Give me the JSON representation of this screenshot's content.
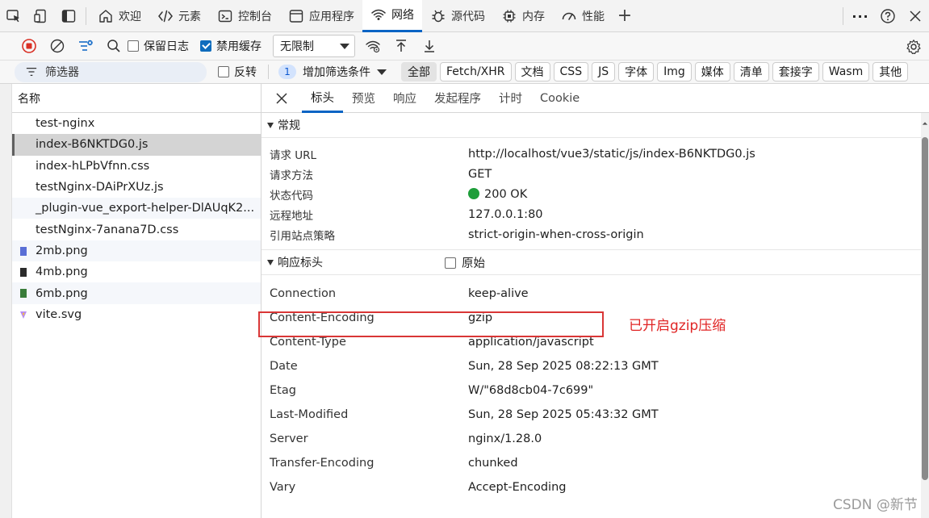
{
  "topbar": {
    "tabs": [
      {
        "label": "欢迎",
        "icon": "home-icon"
      },
      {
        "label": "元素",
        "icon": "code-icon"
      },
      {
        "label": "控制台",
        "icon": "console-icon"
      },
      {
        "label": "应用程序",
        "icon": "application-icon"
      },
      {
        "label": "网络",
        "icon": "wifi-icon",
        "active": true
      },
      {
        "label": "源代码",
        "icon": "bug-icon"
      },
      {
        "label": "内存",
        "icon": "memory-icon"
      },
      {
        "label": "性能",
        "icon": "performance-icon"
      }
    ],
    "add_tab": "+",
    "more": "···",
    "help": "?",
    "close": "✕"
  },
  "toolbar": {
    "preserve_log_label": "保留日志",
    "preserve_log_checked": false,
    "disable_cache_label": "禁用缓存",
    "disable_cache_checked": true,
    "throttling_value": "无限制"
  },
  "filterbar": {
    "filter_placeholder": "筛选器",
    "invert_label": "反转",
    "invert_checked": false,
    "more_filters_count": "1",
    "more_filters_label": "增加筛选条件",
    "types": [
      "全部",
      "Fetch/XHR",
      "文档",
      "CSS",
      "JS",
      "字体",
      "Img",
      "媒体",
      "清单",
      "套接字",
      "Wasm",
      "其他"
    ],
    "active_type": "全部"
  },
  "requests": {
    "header": "名称",
    "items": [
      {
        "name": "test-nginx",
        "type": "doc"
      },
      {
        "name": "index-B6NKTDG0.js",
        "type": "js",
        "selected": true
      },
      {
        "name": "index-hLPbVfnn.css",
        "type": "css"
      },
      {
        "name": "testNginx-DAiPrXUz.js",
        "type": "js"
      },
      {
        "name": "_plugin-vue_export-helper-DlAUqK2...",
        "type": "js"
      },
      {
        "name": "testNginx-7anana7D.css",
        "type": "css"
      },
      {
        "name": "2mb.png",
        "type": "img",
        "icon_color": "#5a6fd6"
      },
      {
        "name": "4mb.png",
        "type": "img",
        "icon_color": "#2b2b2b"
      },
      {
        "name": "6mb.png",
        "type": "img",
        "icon_color": "#3a7d3a"
      },
      {
        "name": "vite.svg",
        "type": "svg",
        "icon_color": "#b68cf5"
      }
    ]
  },
  "details": {
    "tabs": [
      "标头",
      "预览",
      "响应",
      "发起程序",
      "计时",
      "Cookie"
    ],
    "active_tab": "标头",
    "general": {
      "title": "常规",
      "rows": [
        {
          "k": "请求 URL",
          "v": "http://localhost/vue3/static/js/index-B6NKTDG0.js"
        },
        {
          "k": "请求方法",
          "v": "GET"
        },
        {
          "k": "状态代码",
          "v": "200 OK",
          "status_color": "#1e9e3a"
        },
        {
          "k": "远程地址",
          "v": "127.0.0.1:80"
        },
        {
          "k": "引用站点策略",
          "v": "strict-origin-when-cross-origin"
        }
      ]
    },
    "response_headers": {
      "title": "响应标头",
      "raw_label": "原始",
      "raw_checked": false,
      "rows": [
        {
          "k": "Connection",
          "v": "keep-alive"
        },
        {
          "k": "Content-Encoding",
          "v": "gzip"
        },
        {
          "k": "Content-Type",
          "v": "application/javascript"
        },
        {
          "k": "Date",
          "v": "Sun, 28 Sep 2025 08:22:13 GMT"
        },
        {
          "k": "Etag",
          "v": "W/\"68d8cb04-7c699\""
        },
        {
          "k": "Last-Modified",
          "v": "Sun, 28 Sep 2025 05:43:32 GMT"
        },
        {
          "k": "Server",
          "v": "nginx/1.28.0"
        },
        {
          "k": "Transfer-Encoding",
          "v": "chunked"
        },
        {
          "k": "Vary",
          "v": "Accept-Encoding"
        }
      ]
    }
  },
  "annotation": {
    "text": "已开启gzip压缩",
    "color": "#e02424"
  },
  "watermark": "CSDN @新节"
}
